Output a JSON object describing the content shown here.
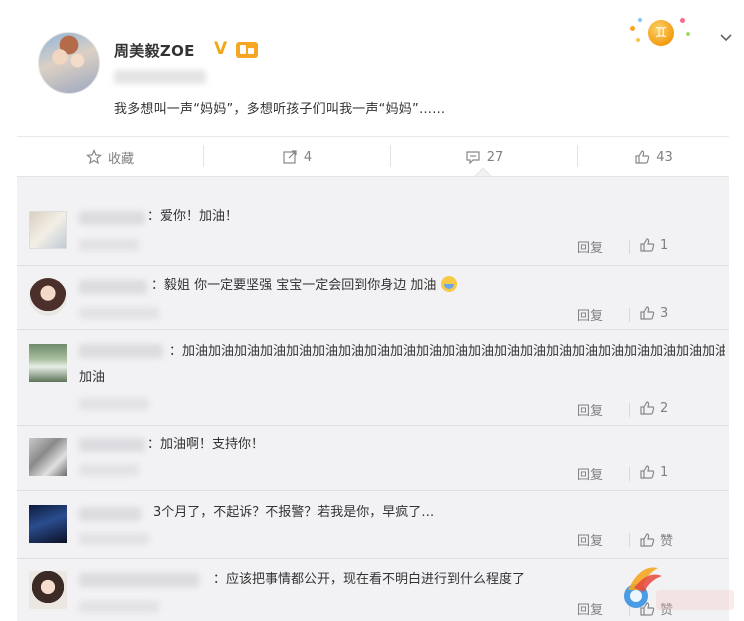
{
  "post": {
    "username": "周美毅ZOE",
    "verified_mark": "V",
    "text": "我多想叫一声“妈妈”，多想听孩子们叫我一声“妈妈”……",
    "zodiac_glyph": "♊",
    "zodiac_icon": "gemini-icon",
    "more_icon": "chevron-down-icon"
  },
  "actions": {
    "favorite_label": "收藏",
    "repost_count": "4",
    "comment_count": "27",
    "like_count": "43"
  },
  "comments": [
    {
      "text": "：爱你！加油！",
      "reply_label": "回复",
      "like_count": "1"
    },
    {
      "text": "：毅姐 你一定要坚强 宝宝一定会回到你身边 加油",
      "reply_label": "回复",
      "like_count": "3"
    },
    {
      "text": "：加油加油加油加油加油加油加油加油加油加油加油加油加油加油加油加油加油加油加油加油加油",
      "text_wrap": "加油",
      "reply_label": "回复",
      "like_count": "2"
    },
    {
      "text": "：加油啊！支持你！",
      "reply_label": "回复",
      "like_count": "1"
    },
    {
      "text": "3个月了，不起诉？不报警？若我是你，早疯了…",
      "reply_label": "回复",
      "like_count": "赞"
    },
    {
      "text": "：应该把事情都公开，现在看不明白进行到什么程度了",
      "reply_label": "回复",
      "like_count": "赞"
    }
  ],
  "colors": {
    "accent_orange": "#f5a623",
    "muted_text": "#808080",
    "comment_bg": "#f2f2f5"
  }
}
